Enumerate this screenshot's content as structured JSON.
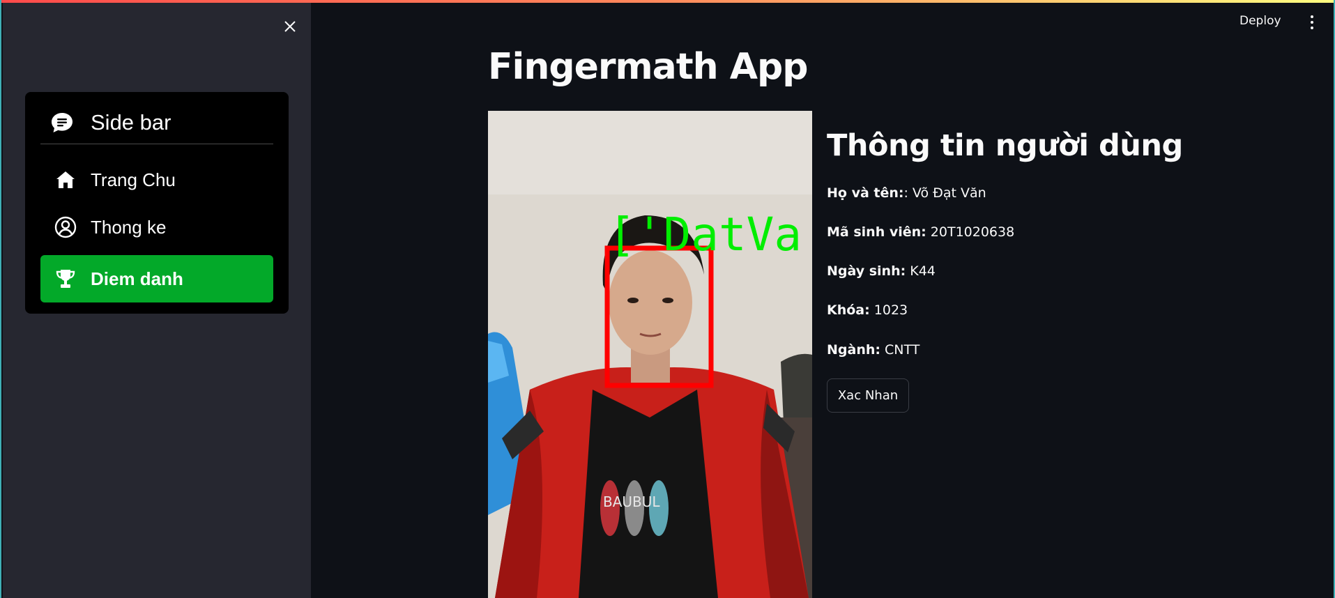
{
  "app": {
    "title": "Fingermath App"
  },
  "header": {
    "deploy_label": "Deploy",
    "menu_icon": "kebab-vertical-icon"
  },
  "sidebar": {
    "close_icon": "close-icon",
    "menu_title": "Side bar",
    "menu_title_icon": "chat-bubble-icon",
    "items": [
      {
        "label": "Trang Chu",
        "icon": "house-icon",
        "active": false
      },
      {
        "label": "Thong ke",
        "icon": "person-circle-icon",
        "active": false
      },
      {
        "label": "Diem danh",
        "icon": "trophy-icon",
        "active": true
      }
    ],
    "active_color": "#03a929"
  },
  "camera": {
    "detection_label": "['DatVa",
    "box_color": "#ff0000",
    "label_color": "#00ff00",
    "shirt_text": "BAUBUL"
  },
  "user_info": {
    "title": "Thông tin người dùng",
    "fields": [
      {
        "label": "Họ và tên:",
        "value": ": Võ Đạt Văn"
      },
      {
        "label": "Mã sinh viên:",
        "value": " 20T1020638"
      },
      {
        "label": "Ngày sinh:",
        "value": " K44"
      },
      {
        "label": "Khóa:",
        "value": " 1023"
      },
      {
        "label": "Ngành:",
        "value": " CNTT"
      }
    ],
    "confirm_label": "Xac Nhan"
  },
  "colors": {
    "background": "#0e1117",
    "sidebar": "#262730",
    "accent_stripe": "#ff4b4b"
  }
}
